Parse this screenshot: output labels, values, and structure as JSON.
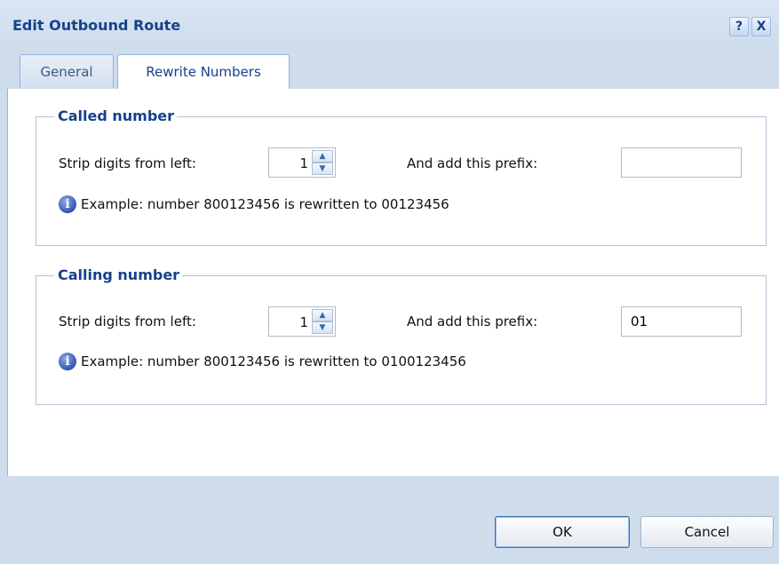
{
  "window": {
    "title": "Edit Outbound Route",
    "help_label": "?",
    "close_label": "X"
  },
  "tabs": [
    {
      "label": "General",
      "active": false
    },
    {
      "label": "Rewrite Numbers",
      "active": true
    }
  ],
  "called": {
    "legend": "Called number",
    "strip_label": "Strip digits from left:",
    "strip_value": "1",
    "prefix_label": "And add this prefix:",
    "prefix_value": "",
    "example": "Example: number 800123456 is rewritten to 00123456"
  },
  "calling": {
    "legend": "Calling number",
    "strip_label": "Strip digits from left:",
    "strip_value": "1",
    "prefix_label": "And add this prefix:",
    "prefix_value": "01",
    "example": "Example: number 800123456 is rewritten to 0100123456"
  },
  "buttons": {
    "ok": "OK",
    "cancel": "Cancel"
  },
  "icons": {
    "info": "info-icon",
    "spin_up": "chevron-up-icon",
    "spin_down": "chevron-down-icon"
  },
  "colors": {
    "title": "#15428b",
    "frame": "#cfdcec",
    "border": "#8db2e3"
  }
}
